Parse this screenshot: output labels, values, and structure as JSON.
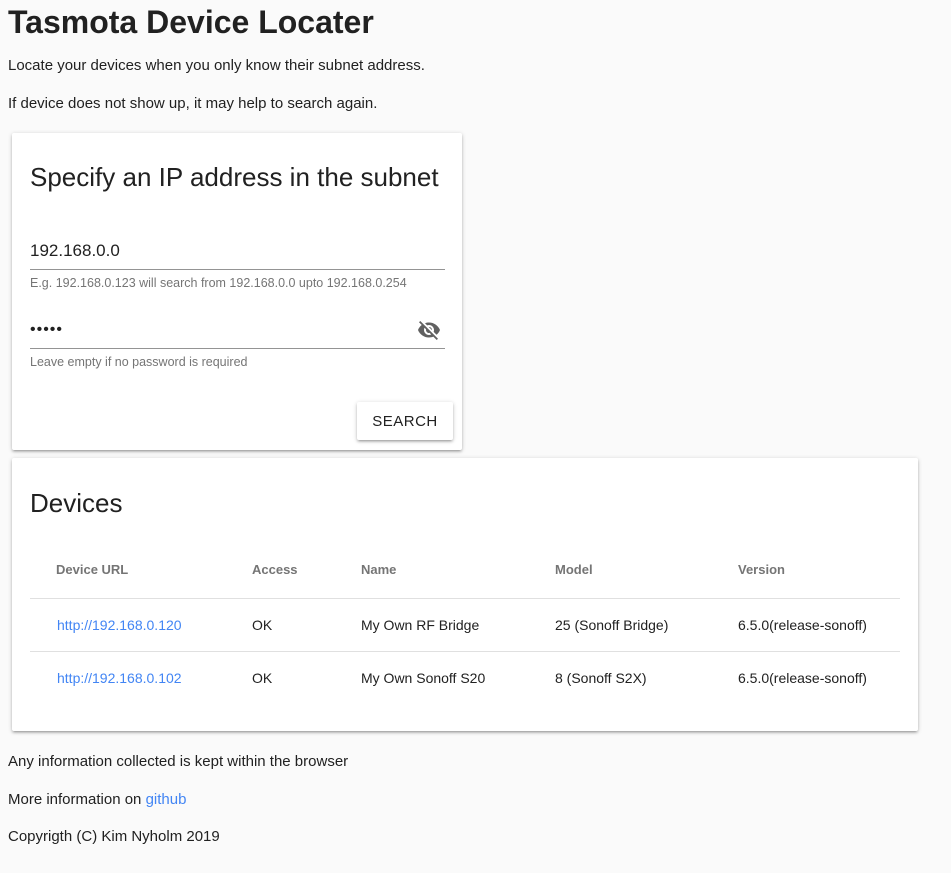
{
  "page": {
    "title": "Tasmota Device Locater",
    "intro_line1": "Locate your devices when you only know their subnet address.",
    "intro_line2": "If device does not show up, it may help to search again."
  },
  "search_card": {
    "title": "Specify an IP address in the subnet",
    "ip_value": "192.168.0.0",
    "ip_hint": "E.g. 192.168.0.123 will search from 192.168.0.0 upto 192.168.0.254",
    "password_value": "•••••",
    "password_hint": "Leave empty if no password is required",
    "password_toggle_icon": "eye-off-icon",
    "search_label": "SEARCH"
  },
  "devices_card": {
    "title": "Devices",
    "columns": [
      "Device URL",
      "Access",
      "Name",
      "Model",
      "Version"
    ],
    "rows": [
      {
        "url": "http://192.168.0.120",
        "access": "OK",
        "name": "My Own RF Bridge",
        "model": "25 (Sonoff Bridge)",
        "version": "6.5.0(release-sonoff)"
      },
      {
        "url": "http://192.168.0.102",
        "access": "OK",
        "name": "My Own Sonoff S20",
        "model": "8 (Sonoff S2X)",
        "version": "6.5.0(release-sonoff)"
      }
    ]
  },
  "footer": {
    "info": "Any information collected is kept within the browser",
    "more_prefix": "More information on ",
    "github_label": "github",
    "copyright": "Copyrigth (C) Kim Nyholm 2019"
  },
  "colors": {
    "background": "#fafafa",
    "link": "#4285f4",
    "text": "#212121",
    "muted": "#757575"
  }
}
